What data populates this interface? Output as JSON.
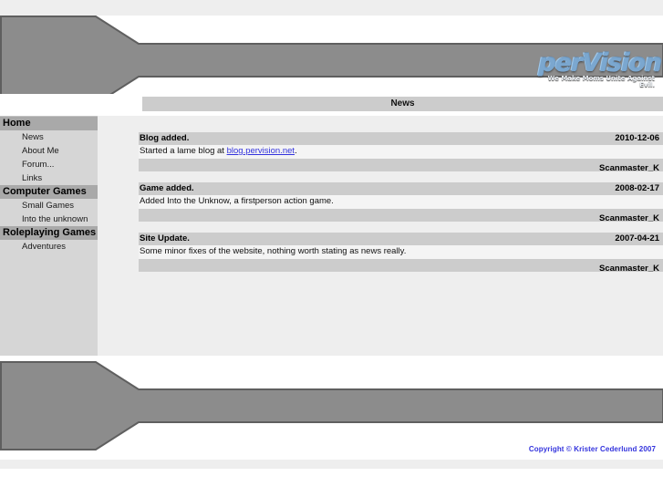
{
  "site": {
    "logo_word": "perVision",
    "logo_tagline": "We Make Moms Unite Against Evil.",
    "accent_link_color": "#3333dd",
    "banner_color": "#8c8c8c",
    "banner_border_color": "#5f5f5f",
    "sidebar_bg_color": "#d6d6d6",
    "nav_header_bg_color": "#a9a9a9",
    "main_bg_color": "#eeeeee"
  },
  "page_title": "News",
  "sidebar": {
    "groups": [
      {
        "header": "Home",
        "items": [
          {
            "label": "News"
          },
          {
            "label": "About Me"
          },
          {
            "label": "Forum..."
          },
          {
            "label": "Links"
          }
        ]
      },
      {
        "header": "Computer Games",
        "items": [
          {
            "label": "Small Games"
          },
          {
            "label": "Into the unknown"
          }
        ]
      },
      {
        "header": "Roleplaying Games",
        "items": [
          {
            "label": "Adventures"
          }
        ]
      }
    ]
  },
  "news": [
    {
      "title": "Blog added.",
      "date": "2010-12-06",
      "body_before": "Started a lame blog at ",
      "body_link": "blog.pervision.net",
      "body_after": ".",
      "author": "Scanmaster_K"
    },
    {
      "title": "Game added.",
      "date": "2008-02-17",
      "body_before": "Added Into the Unknow, a firstperson action game.",
      "body_link": "",
      "body_after": "",
      "author": "Scanmaster_K"
    },
    {
      "title": "Site Update.",
      "date": "2007-04-21",
      "body_before": "Some minor fixes of the website, nothing worth stating as news really.",
      "body_link": "",
      "body_after": "",
      "author": "Scanmaster_K"
    }
  ],
  "footer": {
    "copyright": "Copyright © Krister Cederlund 2007"
  }
}
